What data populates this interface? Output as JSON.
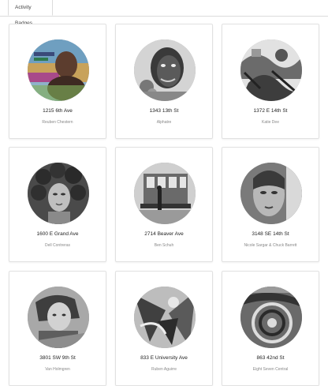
{
  "tabs": {
    "active": "Activity Badges"
  },
  "badges": [
    {
      "address": "1215 6th Ave",
      "artist": "Reuben Chestern",
      "image": "colorful-mural-portrait"
    },
    {
      "address": "1343 13th St",
      "artist": "Alphatre",
      "image": "grayscale-face-mural"
    },
    {
      "address": "1372 E 14th St",
      "artist": "Katie Dee",
      "image": "abstract-mural"
    },
    {
      "address": "1600 E Grand Ave",
      "artist": "Dell Contreras",
      "image": "woman-with-curly-hair-mural"
    },
    {
      "address": "2714 Beaver Ave",
      "artist": "Ben Schuh",
      "image": "trolley-car-mural"
    },
    {
      "address": "3148 SE 14th St",
      "artist": "Nicole Sargar & Chuck Barrett",
      "image": "woman-face-mural"
    },
    {
      "address": "3801 SW 9th St",
      "artist": "Van Holmgren",
      "image": "woman-portrait-mural"
    },
    {
      "address": "833 E University Ave",
      "artist": "Ruben Aguirre",
      "image": "abstract-shapes-mural"
    },
    {
      "address": "863 42nd St",
      "artist": "Eight Seven Central",
      "image": "spiral-pattern-mural"
    }
  ]
}
